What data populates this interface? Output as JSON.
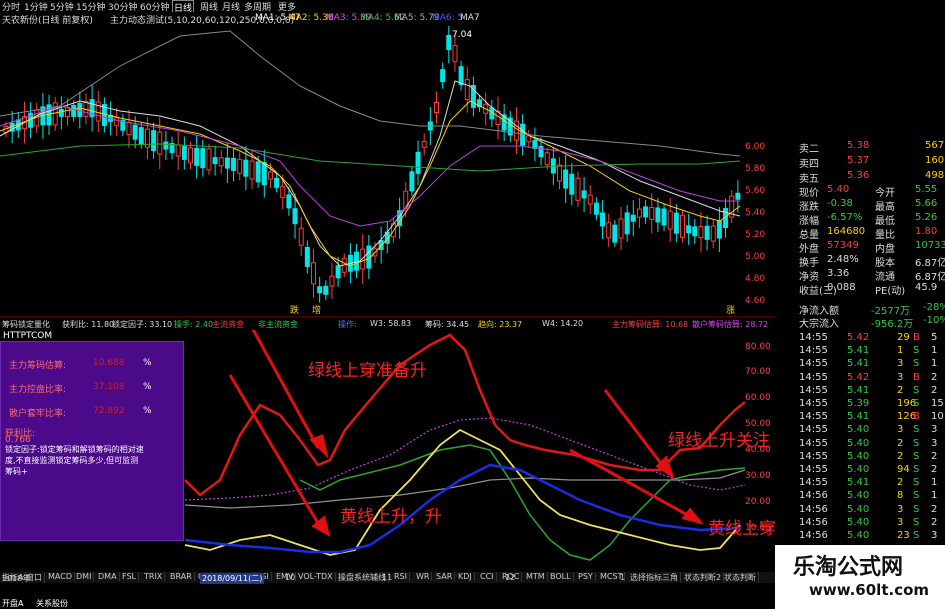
{
  "topbar": {
    "periods": [
      "分时",
      "1分钟",
      "5分钟",
      "15分钟",
      "30分钟",
      "60分钟",
      "日线",
      "周线",
      "月线",
      "多周期",
      "更多"
    ],
    "active": "日线"
  },
  "title_row": {
    "chart_name": "天农新份(日线 前复权)",
    "indicator_name": "主力动态测试(5,10,20,60,120,250,0,0,0,0)",
    "ma1": "MA1: 5.47",
    "ma2": "MA2: 5.36",
    "ma3": "MA3: 5.39",
    "ma4": "MA4: 5.62",
    "ma5": "MA5: 5.79",
    "ma6": "MA6: 5.",
    "ma7": "MA7"
  },
  "main_chart": {
    "price_labels": [
      "6.00",
      "5.80",
      "5.60",
      "5.40",
      "5.20",
      "5.00",
      "4.80",
      "4.60"
    ],
    "high_label": "7.04",
    "markers": [
      "跌",
      "增",
      "涨"
    ]
  },
  "indicator_row": {
    "name": "筹码锁定量化",
    "items": [
      "获利比: 11.80",
      "锁定因子: 33.10",
      "操手: 2.40",
      "主流资金",
      "非主流资金",
      "操作:",
      "W3: 58.83",
      "筹码: 34.45",
      "趋向: 23.37",
      "W4: 14.20",
      "主力筹码估算: 10.68",
      "散户筹码估算: 28.72"
    ]
  },
  "indicator": {
    "axis_labels": [
      "80.00",
      "70.00",
      "60.00",
      "50.00",
      "40.00",
      "30.00",
      "20.00",
      "10.00"
    ],
    "watermark_text": "HTTPTCOM"
  },
  "purple_box": {
    "rows": [
      {
        "label": "主力筹码估算:",
        "value": "10.688",
        "pct": "%"
      },
      {
        "label": "主力控盘比率:",
        "value": "37.108",
        "pct": "%"
      },
      {
        "label": "散户套牢比率:",
        "value": "72.892",
        "pct": "%"
      }
    ],
    "profit_label": "获利比:",
    "profit_value": "0.766",
    "note": "锁定因子:锁定筹码和解锁筹码的相对速度,不直接监测锁定筹码多少,但可监测筹码+"
  },
  "annotations": {
    "a1": "绿线上穿准备升",
    "a2": "黄线上升，升",
    "a3": "绿线上升关注",
    "a4": "黄线上穿，升!"
  },
  "bottom_tabs": [
    "指标A",
    "窗口",
    "MACD",
    "DMI",
    "DMA",
    "FSL",
    "TRIX",
    "BRAR",
    "CR",
    "VR",
    "OBV",
    "ASI",
    "EMV",
    "VOL-TDX",
    "操盘系统辅线",
    "RSI",
    "WR",
    "SAR",
    "KDJ",
    "CCI",
    "ROC",
    "MTM",
    "BOLL",
    "PSY",
    "MCST",
    "选择指标三角",
    "状态判断2",
    "状态判断"
  ],
  "bottom_status": {
    "year": "2018年",
    "date_highlight": "2018/09/11(二)",
    "ticks": [
      "10",
      "11",
      "12",
      "1"
    ],
    "status1": "开盘A",
    "status2": "关系股份"
  },
  "right_panel": {
    "sell_quotes": [
      {
        "label": "卖二",
        "price": "5.38",
        "vol": "567"
      },
      {
        "label": "卖四",
        "price": "5.37",
        "vol": "160"
      },
      {
        "label": "卖五",
        "price": "5.36",
        "vol": "498"
      }
    ],
    "stats": [
      {
        "l1": "现价",
        "v1": "5.40",
        "l2": "今开",
        "v2": "5.55"
      },
      {
        "l1": "涨跌",
        "v1": "-0.38",
        "l2": "最高",
        "v2": "5.66"
      },
      {
        "l1": "涨幅",
        "v1": "-6.57%",
        "l2": "最低",
        "v2": "5.26"
      },
      {
        "l1": "总量",
        "v1": "164680",
        "l2": "量比",
        "v2": "1.80"
      },
      {
        "l1": "外盘",
        "v1": "57349",
        "l2": "内盘",
        "v2": "107331"
      },
      {
        "l1": "换手",
        "v1": "2.48%",
        "l2": "股本",
        "v2": "6.87亿"
      },
      {
        "l1": "净资",
        "v1": "3.36",
        "l2": "流通",
        "v2": "6.87亿"
      },
      {
        "l1": "收益(三)",
        "v1": "0.088",
        "l2": "PE(动)",
        "v2": "45.9"
      }
    ],
    "flow": [
      {
        "label": "净流入额",
        "v1": "-2577万",
        "v2": "-28%"
      },
      {
        "label": "大宗流入",
        "v1": "-956.2万",
        "v2": "-10%"
      }
    ],
    "ticks": [
      {
        "t": "14:55",
        "p": "5.42",
        "v": "29",
        "s": "B",
        "n": "5"
      },
      {
        "t": "14:55",
        "p": "5.41",
        "v": "1",
        "s": "S",
        "n": "1"
      },
      {
        "t": "14:55",
        "p": "5.41",
        "v": "3",
        "s": "S",
        "n": "1"
      },
      {
        "t": "14:55",
        "p": "5.42",
        "v": "3",
        "s": "B",
        "n": "2"
      },
      {
        "t": "14:55",
        "p": "5.41",
        "v": "2",
        "s": "S",
        "n": "2"
      },
      {
        "t": "14:55",
        "p": "5.39",
        "v": "196",
        "s": "S",
        "n": "15"
      },
      {
        "t": "14:55",
        "p": "5.41",
        "v": "126",
        "s": "B",
        "n": "10"
      },
      {
        "t": "14:55",
        "p": "5.40",
        "v": "3",
        "s": "S",
        "n": "3"
      },
      {
        "t": "14:55",
        "p": "5.40",
        "v": "2",
        "s": "S",
        "n": "3"
      },
      {
        "t": "14:55",
        "p": "5.40",
        "v": "2",
        "s": "S",
        "n": "2"
      },
      {
        "t": "14:55",
        "p": "5.40",
        "v": "94",
        "s": "S",
        "n": "2"
      },
      {
        "t": "14:55",
        "p": "5.41",
        "v": "2",
        "s": "S",
        "n": "1"
      },
      {
        "t": "14:56",
        "p": "5.40",
        "v": "8",
        "s": "S",
        "n": "1"
      },
      {
        "t": "14:56",
        "p": "5.40",
        "v": "3",
        "s": "S",
        "n": "2"
      },
      {
        "t": "14:56",
        "p": "5.40",
        "v": "3",
        "s": "S",
        "n": "2"
      },
      {
        "t": "14:56",
        "p": "5.40",
        "v": "23",
        "s": "S",
        "n": "3"
      }
    ]
  },
  "watermark": {
    "title": "乐淘公式网",
    "url": "www.60lt.com"
  },
  "colors": {
    "up": "#ff3b3b",
    "down": "#00e5e5",
    "purple_box": "#4a0a8a",
    "red_line": "#e01818",
    "yellow_line": "#f0e060",
    "blue_line": "#1a2de0",
    "green_line": "#2aa82a",
    "gray_line": "#909090"
  }
}
